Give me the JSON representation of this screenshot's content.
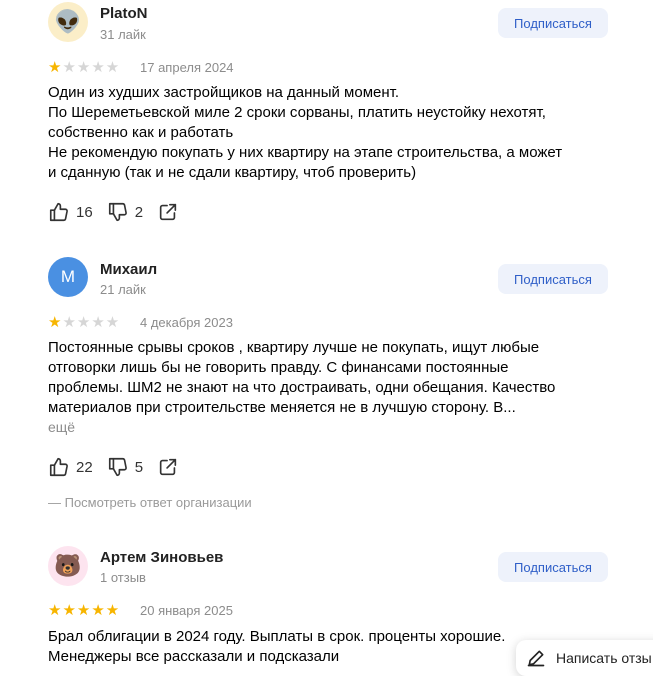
{
  "reviews": [
    {
      "author": "PlatoN",
      "avatar_emoji": "👽",
      "sub": "31 лайк",
      "subscribe": "Подписаться",
      "rating": 1,
      "date": "17 апреля 2024",
      "lines": [
        "Один из худших застройщиков на данный момент.",
        "По Шереметьевской миле 2 сроки сорваны, платить неустойку нехотят,",
        "собственно как и работать",
        "Не рекомендую покупать у них квартиру на этапе строительства, а может",
        "и сданную (так и не сдали квартиру, чтоб проверить)"
      ],
      "likes": "16",
      "dislikes": "2"
    },
    {
      "author": "Михаил",
      "avatar_letter": "М",
      "sub": "21 лайк",
      "subscribe": "Подписаться",
      "rating": 1,
      "date": "4 декабря 2023",
      "lines": [
        "Постоянные срывы сроков , квартиру лучше не покупать, ищут любые",
        "отговорки лишь бы не говорить правду. С финансами постоянные",
        "проблемы. ШМ2 не знают на что достраивать, одни обещания. Качество",
        "материалов при строительстве меняется не в лучшую сторону. В..."
      ],
      "more": "ещё",
      "likes": "22",
      "dislikes": "5",
      "org_link": "— Посмотреть ответ организации"
    },
    {
      "author": "Артем Зиновьев",
      "avatar_emoji": "🐻",
      "sub": "1 отзыв",
      "subscribe": "Подписаться",
      "rating": 5,
      "date": "20 января 2025",
      "lines": [
        "Брал облигации в 2024 году. Выплаты в срок. проценты хорошие.",
        "Менеджеры все рассказали и подсказали"
      ]
    }
  ],
  "write_review": "Написать отзы",
  "colors": {
    "star": "#f7b500",
    "star_empty": "#d6d6d6",
    "subscribe_bg": "#eef2fb",
    "subscribe_text": "#2f5fc8",
    "avatar_m": "#4a90e2"
  }
}
